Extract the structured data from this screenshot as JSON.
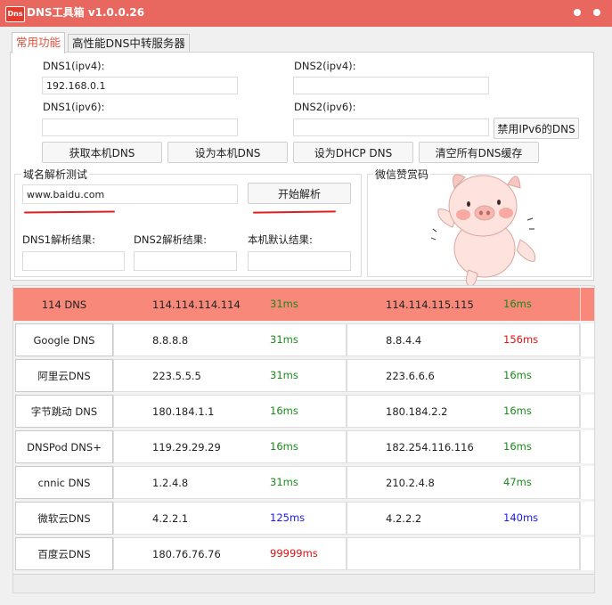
{
  "window": {
    "app_icon_text": "Dns",
    "title": "DNS工具箱 v1.0.0.26"
  },
  "tabs": [
    {
      "label": "常用功能",
      "active": true
    },
    {
      "label": "高性能DNS中转服务器",
      "active": false
    }
  ],
  "dns_config": {
    "dns1_ipv4_label": "DNS1(ipv4):",
    "dns1_ipv4_value": "192.168.0.1",
    "dns2_ipv4_label": "DNS2(ipv4):",
    "dns2_ipv4_value": "",
    "dns1_ipv6_label": "DNS1(ipv6):",
    "dns1_ipv6_value": "",
    "dns2_ipv6_label": "DNS2(ipv6):",
    "dns2_ipv6_value": "",
    "disable_ipv6_button": "禁用IPv6的DNS"
  },
  "actions": {
    "get_local": "获取本机DNS",
    "set_local": "设为本机DNS",
    "set_dhcp": "设为DHCP DNS",
    "flush_cache": "清空所有DNS缓存"
  },
  "resolve_test": {
    "group_title": "域名解析测试",
    "domain_value": "www.baidu.com",
    "start_button": "开始解析",
    "dns1_result_label": "DNS1解析结果:",
    "dns2_result_label": "DNS2解析结果:",
    "local_result_label": "本机默认结果:",
    "dns1_result_value": "",
    "dns2_result_value": "",
    "local_result_value": ""
  },
  "donate": {
    "group_title": "微信赞赏码"
  },
  "colors": {
    "titlebar": "#e8675e",
    "highlight_row": "#f8887a",
    "latency_green": "#1a8a1a",
    "latency_red": "#e01010",
    "latency_blue": "#1a1aee",
    "active_tab": "#e0523f"
  },
  "dns_table": [
    {
      "name": "114 DNS",
      "ip1": "114.114.114.114",
      "lat1": "31ms",
      "lat1_color": "green",
      "ip2": "114.114.115.115",
      "lat2": "16ms",
      "lat2_color": "green"
    },
    {
      "name": "Google DNS",
      "ip1": "8.8.8.8",
      "lat1": "31ms",
      "lat1_color": "green",
      "ip2": "8.8.4.4",
      "lat2": "156ms",
      "lat2_color": "red"
    },
    {
      "name": "阿里云DNS",
      "ip1": "223.5.5.5",
      "lat1": "31ms",
      "lat1_color": "green",
      "ip2": "223.6.6.6",
      "lat2": "16ms",
      "lat2_color": "green"
    },
    {
      "name": "字节跳动 DNS",
      "ip1": "180.184.1.1",
      "lat1": "16ms",
      "lat1_color": "green",
      "ip2": "180.184.2.2",
      "lat2": "16ms",
      "lat2_color": "green"
    },
    {
      "name": "DNSPod DNS+",
      "ip1": "119.29.29.29",
      "lat1": "16ms",
      "lat1_color": "green",
      "ip2": "182.254.116.116",
      "lat2": "16ms",
      "lat2_color": "green"
    },
    {
      "name": "cnnic DNS",
      "ip1": "1.2.4.8",
      "lat1": "31ms",
      "lat1_color": "green",
      "ip2": "210.2.4.8",
      "lat2": "47ms",
      "lat2_color": "green"
    },
    {
      "name": "微软云DNS",
      "ip1": "4.2.2.1",
      "lat1": "125ms",
      "lat1_color": "blue",
      "ip2": "4.2.2.2",
      "lat2": "140ms",
      "lat2_color": "blue"
    },
    {
      "name": "百度云DNS",
      "ip1": "180.76.76.76",
      "lat1": "99999ms",
      "lat1_color": "red",
      "ip2": "",
      "lat2": "",
      "lat2_color": "green"
    }
  ]
}
